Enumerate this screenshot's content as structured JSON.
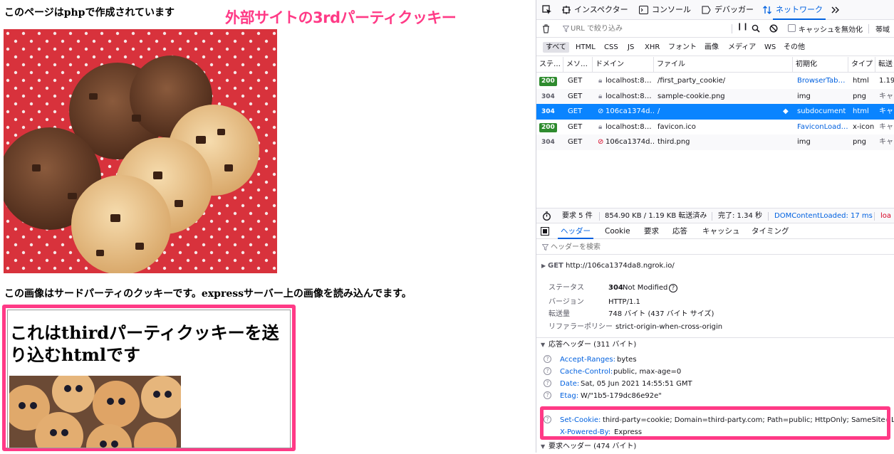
{
  "page": {
    "heading": "このページはphpで作成されています",
    "annotation_title": "外部サイトの3rdパーティクッキー",
    "caption": "この画像はサードパーティのクッキーです。expressサーバー上の画像を読み込んでます。",
    "iframe_heading": "これはthirdパーティクッキーを送り込むhtmlです"
  },
  "devtools": {
    "toolbar": {
      "inspector": "インスペクター",
      "console": "コンソール",
      "debugger": "デバッガー",
      "network": "ネットワーク"
    },
    "filter": {
      "placeholder": "URL で絞り込み",
      "disable_cache": "キャッシュを無効化",
      "throttle": "帯域"
    },
    "types": [
      "すべて",
      "HTML",
      "CSS",
      "JS",
      "XHR",
      "フォント",
      "画像",
      "メディア",
      "WS",
      "その他"
    ],
    "columns": [
      "ステ…",
      "メソ…",
      "ドメイン",
      "ファイル",
      "初期化",
      "タイプ",
      "転送"
    ],
    "requests": [
      {
        "status": "200",
        "method": "GET",
        "domain": "localhost:8…",
        "file": "/first_party_cookie/",
        "initiator": "BrowserTab…",
        "type": "html",
        "transfer": "1.19"
      },
      {
        "status": "304",
        "method": "GET",
        "domain": "localhost:8…",
        "file": "sample-cookie.png",
        "initiator": "img",
        "type": "png",
        "transfer": "キャ"
      },
      {
        "status": "304",
        "method": "GET",
        "domain": "106ca1374d…",
        "file": "/",
        "initiator": "subdocument",
        "type": "html",
        "transfer": "キャ"
      },
      {
        "status": "200",
        "method": "GET",
        "domain": "localhost:8…",
        "file": "favicon.ico",
        "initiator": "FaviconLoad…",
        "type": "x-icon",
        "transfer": "キャ"
      },
      {
        "status": "304",
        "method": "GET",
        "domain": "106ca1374d…",
        "file": "third.png",
        "initiator": "img",
        "type": "png",
        "transfer": "キャ"
      }
    ],
    "statusbar": {
      "requests": "要求 5 件",
      "transferred": "854.90 KB / 1.19 KB 転送済み",
      "finish": "完了: 1.34 秒",
      "dom": "DOMContentLoaded: 17 ms",
      "load": "loa"
    },
    "detail_tabs": [
      "ヘッダー",
      "Cookie",
      "要求",
      "応答",
      "キャッシュ",
      "タイミング"
    ],
    "header_filter_placeholder": "ヘッダーを検索",
    "get_label": "GET",
    "get_url": "http://106ca1374da8.ngrok.io/",
    "summary": [
      {
        "key": "ステータス",
        "value": "Not Modified",
        "code": "304"
      },
      {
        "key": "バージョン",
        "value": "HTTP/1.1"
      },
      {
        "key": "転送量",
        "value": "748 バイト (437 バイト サイズ)"
      },
      {
        "key": "リファラーポリシー",
        "value": "strict-origin-when-cross-origin"
      }
    ],
    "response_headers_title": "応答ヘッダー (311 バイト)",
    "response_headers": [
      {
        "name": "Accept-Ranges:",
        "value": "bytes"
      },
      {
        "name": "Cache-Control:",
        "value": "public, max-age=0"
      },
      {
        "name": "Date:",
        "value": "Sat, 05 Jun 2021 14:55:51 GMT"
      },
      {
        "name": "Etag:",
        "value": "W/\"1b5-179dc86e92e\""
      },
      {
        "name": "Set-Cookie:",
        "value": "third-party=cookie; Domain=third-party.com; Path=public; HttpOnly; SameSite=Lax"
      },
      {
        "name": "X-Powered-By:",
        "value": "Express"
      }
    ],
    "request_headers_title": "要求ヘッダー (474 バイト)",
    "colors": {
      "accent": "#0061e0",
      "highlight": "#ff3a86",
      "selected_row": "#0a84ff",
      "ok": "#2e8b2e"
    }
  }
}
